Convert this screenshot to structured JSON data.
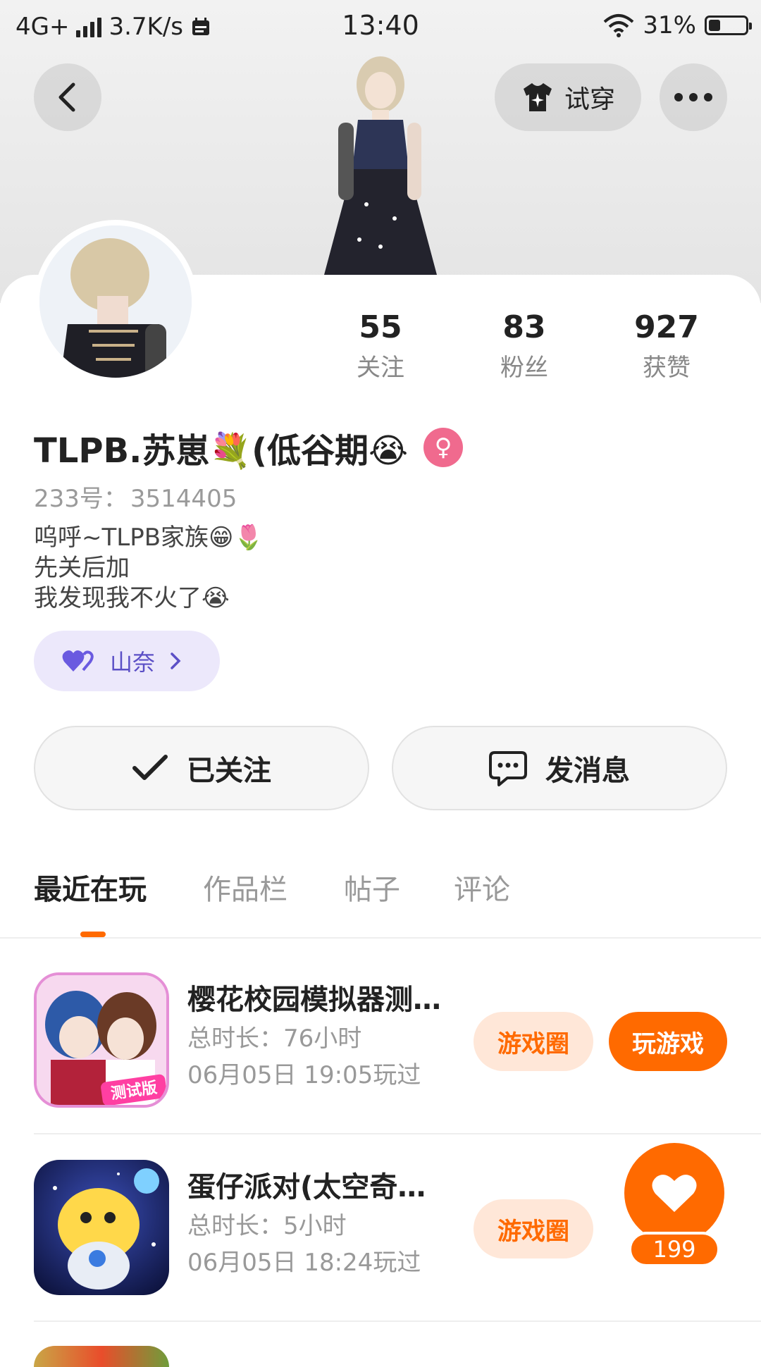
{
  "status_bar": {
    "network": "4G+",
    "speed": "3.7K/s",
    "time": "13:40",
    "battery": "31%",
    "battery_level": 0.31
  },
  "header": {
    "try_on_label": "试穿"
  },
  "profile": {
    "stats": [
      {
        "value": "55",
        "label": "关注"
      },
      {
        "value": "83",
        "label": "粉丝"
      },
      {
        "value": "927",
        "label": "获赞"
      }
    ],
    "name": "TLPB.苏崽💐(低谷期😭",
    "gender_symbol": "♀",
    "id_label": "233号：",
    "id_value": "3514405",
    "bio": [
      "呜呼~TLPB家族😁🌷",
      "先关后加",
      "我发现我不火了😭"
    ],
    "tag_label": "山奈"
  },
  "actions": {
    "follow_label": "已关注",
    "message_label": "发消息"
  },
  "tabs": [
    "最近在玩",
    "作品栏",
    "帖子",
    "评论"
  ],
  "games": [
    {
      "title": "樱花校园模拟器测…",
      "duration": "总时长：76小时",
      "last_played": "06月05日 19:05玩过",
      "circle_label": "游戏圈",
      "play_label": "玩游戏",
      "badge": "测试版"
    },
    {
      "title": "蛋仔派对(太空奇…",
      "duration": "总时长：5小时",
      "last_played": "06月05日 18:24玩过",
      "circle_label": "游戏圈"
    }
  ],
  "like_count": "199",
  "colors": {
    "accent": "#ff6a00",
    "accent_light": "#ffe7d8",
    "tag_bg": "#ece8fb",
    "tag_text": "#5b4fc6"
  }
}
